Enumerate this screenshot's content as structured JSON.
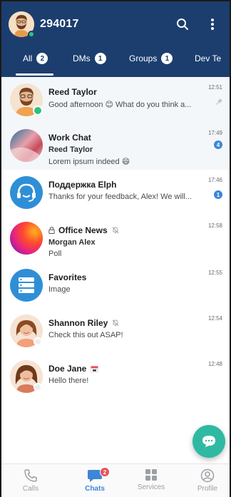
{
  "header": {
    "account_name": "294017",
    "colors": {
      "header_bg": "#1c3e6e",
      "accent": "#3d86d8",
      "online": "#2ec27e",
      "fab": "#2fb9a3",
      "badge_red": "#e8505b"
    }
  },
  "tabs": [
    {
      "label": "All",
      "badge": "2",
      "active": true
    },
    {
      "label": "DMs",
      "badge": "1",
      "active": false
    },
    {
      "label": "Groups",
      "badge": "1",
      "active": false
    },
    {
      "label": "Dev Te",
      "badge": "",
      "active": false
    }
  ],
  "chats": [
    {
      "title": "Reed Taylor",
      "line2": "Good afternoon 😊 What do you think a...",
      "time": "12:51",
      "pinned": true,
      "status": "online"
    },
    {
      "title": "Work Chat",
      "sender": "Reed Taylor",
      "line3": "Lorem ipsum indeed 😄",
      "time": "17:49",
      "unread": "4"
    },
    {
      "title": "Поддержка Elph",
      "line2": "Thanks for your feedback, Alex! We will...",
      "time": "17:46",
      "unread": "1"
    },
    {
      "title": "Office News",
      "sender": "Morgan Alex",
      "line3": "Poll",
      "time": "12:58",
      "locked": true,
      "muted": true
    },
    {
      "title": "Favorites",
      "line2": "Image",
      "time": "12:55"
    },
    {
      "title": "Shannon Riley",
      "line2": "Check this out ASAP!",
      "time": "12:54",
      "muted": true,
      "status": "offline"
    },
    {
      "title": "Doe Jane",
      "line2": "Hello there!",
      "time": "12:48",
      "calendar_icon": true,
      "status": "offline"
    }
  ],
  "bottom_nav": [
    {
      "label": "Calls",
      "icon": "phone-icon",
      "active": false
    },
    {
      "label": "Chats",
      "icon": "chat-bubble-icon",
      "active": true,
      "badge": "2"
    },
    {
      "label": "Services",
      "icon": "grid-icon",
      "active": false
    },
    {
      "label": "Profile",
      "icon": "profile-icon",
      "active": false
    }
  ]
}
